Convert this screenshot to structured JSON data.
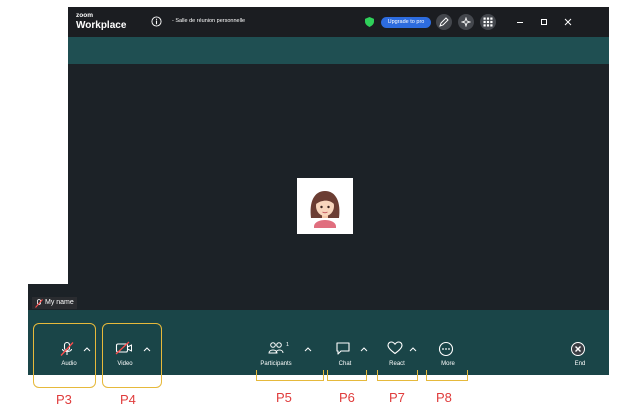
{
  "titlebar": {
    "logo_line1": "zoom",
    "logo_line2": "Workplace",
    "meeting_title": "- Salle de réunion personnelle",
    "upgrade_label": "Upgrade to pro"
  },
  "video": {
    "participant_name": "My name"
  },
  "toolbar": {
    "audio_label": "Audio",
    "video_label": "Video",
    "participants_label": "Participants",
    "participants_count": "1",
    "chat_label": "Chat",
    "react_label": "React",
    "more_label": "More",
    "end_label": "End"
  },
  "annotations": [
    "P3",
    "P4",
    "P5",
    "P6",
    "P7",
    "P8"
  ],
  "colors": {
    "accent": "#e6b93b",
    "annotation_text": "#e03c3c",
    "toolbar": "#1a4548",
    "upgrade": "#2d6cdf"
  }
}
